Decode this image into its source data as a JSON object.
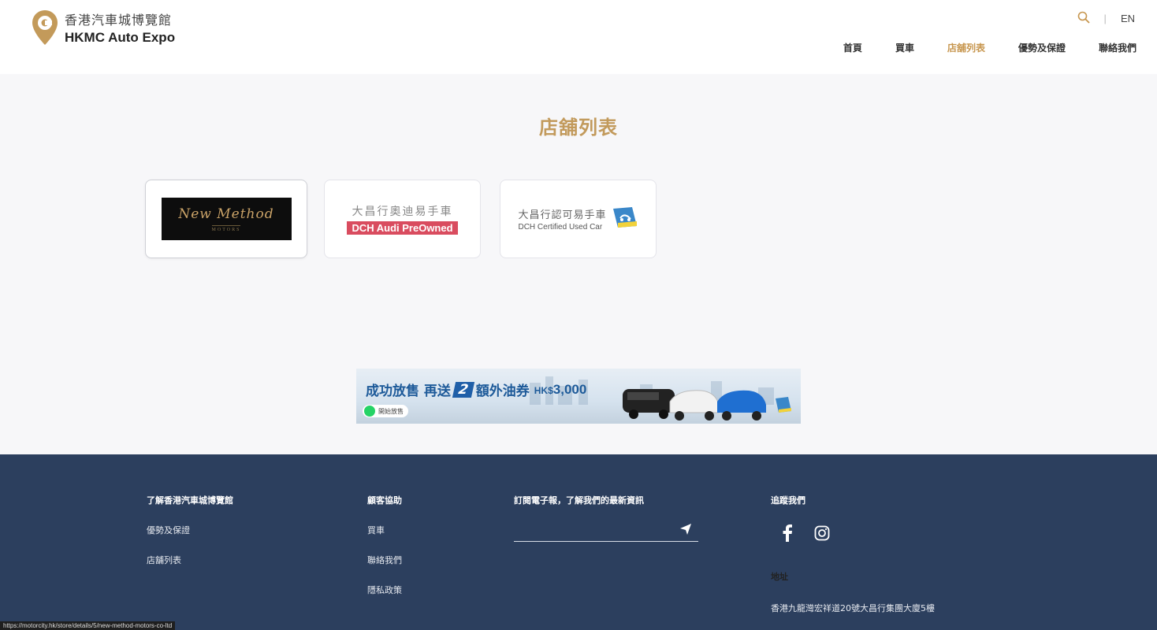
{
  "header": {
    "logo_zh": "香港汽車城博覽館",
    "logo_en": "HKMC Auto Expo",
    "search_icon": "search-icon",
    "separator": "|",
    "language": "EN",
    "nav": [
      {
        "label": "首頁"
      },
      {
        "label": "買車"
      },
      {
        "label": "店舖列表",
        "active": true
      },
      {
        "label": "優勢及保證"
      },
      {
        "label": "聯絡我們"
      }
    ]
  },
  "main": {
    "title": "店舖列表",
    "stores": [
      {
        "script": "New Method",
        "sub": "MOTORS"
      },
      {
        "zh": "大昌行奧迪易手車",
        "en": "DCH Audi PreOwned"
      },
      {
        "zh": "大昌行認可易手車",
        "en": "DCH Certified Used Car"
      }
    ],
    "banner": {
      "headline": "成功放售 再送",
      "number": "2",
      "suffix": "額外油券",
      "amount_prefix": "HK$",
      "amount": "3,000",
      "whatsapp_label": "開始放售"
    }
  },
  "footer": {
    "col1": {
      "heading": "了解香港汽車城博覽館",
      "links": [
        "優勢及保證",
        "店舖列表"
      ]
    },
    "col2": {
      "heading": "顧客協助",
      "links": [
        "買車",
        "聯絡我們",
        "隱私政策"
      ]
    },
    "col3": {
      "heading": "訂閱電子報，了解我們的最新資訊"
    },
    "col4": {
      "heading": "追蹤我們",
      "address_heading": "地址",
      "address": "香港九龍灣宏祥道20號大昌行集團大廈5樓"
    }
  },
  "status_url": "https://motorcity.hk/store/details/5/new-method-motors-co-ltd",
  "colors": {
    "accent": "#c7964e",
    "footer_bg": "#2c3f5e",
    "audi_red": "#d94c5f",
    "banner_blue": "#1d5a99"
  }
}
